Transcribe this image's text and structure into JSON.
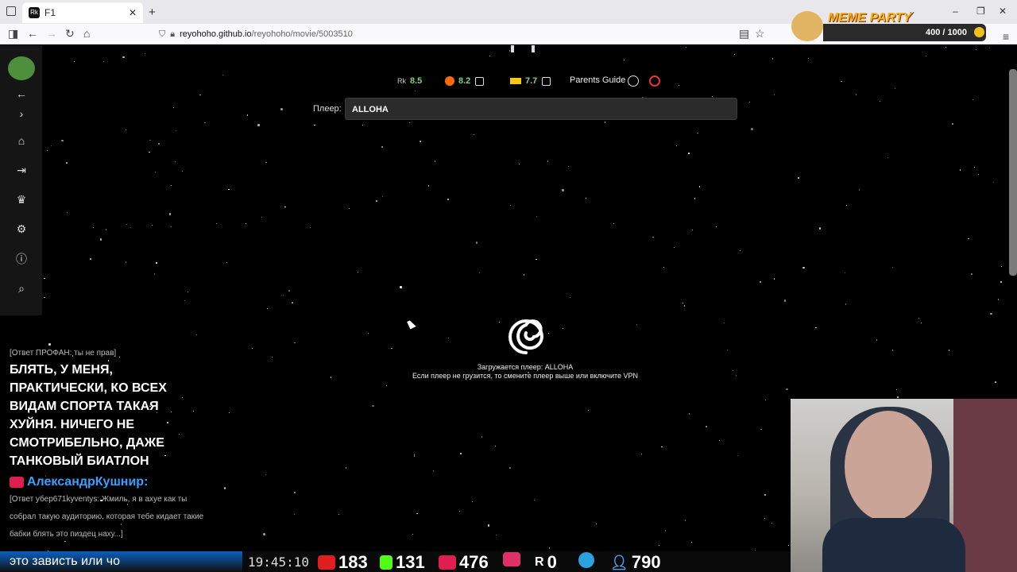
{
  "browser": {
    "tab_title": "F1",
    "tab_icon_label": "Rk",
    "url_host": "reyohoho.github.io",
    "url_path": "/reyohoho/movie/5003510"
  },
  "overlay_top": {
    "brand": "MEME PARTY",
    "progress_text": "400 / 1000",
    "progress": 0.4
  },
  "ratings": [
    {
      "name": "reyohoho-rating-icon",
      "value": "8.5"
    },
    {
      "name": "kinopoisk-rating-icon",
      "value": "8.2"
    },
    {
      "name": "imdb-rating-icon",
      "value": "7.7"
    }
  ],
  "parents_guide": "Parents Guide",
  "player": {
    "label": "Плеер:",
    "selected": "ALLOHA"
  },
  "loading": {
    "line1": "Загружается плеер: ALLOHA",
    "line2": "Если плеер не грузится, то смените плеер выше или включите VPN"
  },
  "sidebar": {
    "items": [
      "back-icon",
      "forward-icon",
      "home-icon",
      "login-icon",
      "trophy-icon",
      "gear-icon",
      "info-icon",
      "search-icon"
    ]
  },
  "chat": {
    "reply1": "[Ответ ПРОФАН: ты не прав]",
    "message": "БЛЯТЬ, У МЕНЯ, ПРАКТИЧЕСКИ, КО ВСЕХ ВИДАМ СПОРТА ТАКАЯ ХУЙНЯ. НИЧЕГО НЕ СМОТРИБЕЛЬНО, ДАЖЕ ТАНКОВЫЙ БИАТЛОН",
    "username": "АлександрКушнир:",
    "reply2": "[Ответ убер671kyventys: Жмиль, я в ахуе как ты собрал такую аудиторию, которая тебе кидает такие бабки блять это пиздец наху...]"
  },
  "bottom": {
    "ticker": "это зависть или чо",
    "time": "19:45:10",
    "stats": [
      {
        "name": "youtube-viewers",
        "value": "183",
        "color": "#e01e1e"
      },
      {
        "name": "kick-viewers",
        "value": "131",
        "color": "#53fc18"
      },
      {
        "name": "vk-live-viewers",
        "value": "476",
        "color": "#e01e4f"
      },
      {
        "name": "rutube-viewers",
        "value": "",
        "color": "#e0306a"
      },
      {
        "name": "r-viewers",
        "value": "0",
        "color": "#ffffff"
      },
      {
        "name": "telegram-viewers",
        "value": "",
        "color": "#2aa3e0"
      },
      {
        "name": "total-viewers",
        "value": "790",
        "color": "#4ca0f0"
      }
    ]
  }
}
